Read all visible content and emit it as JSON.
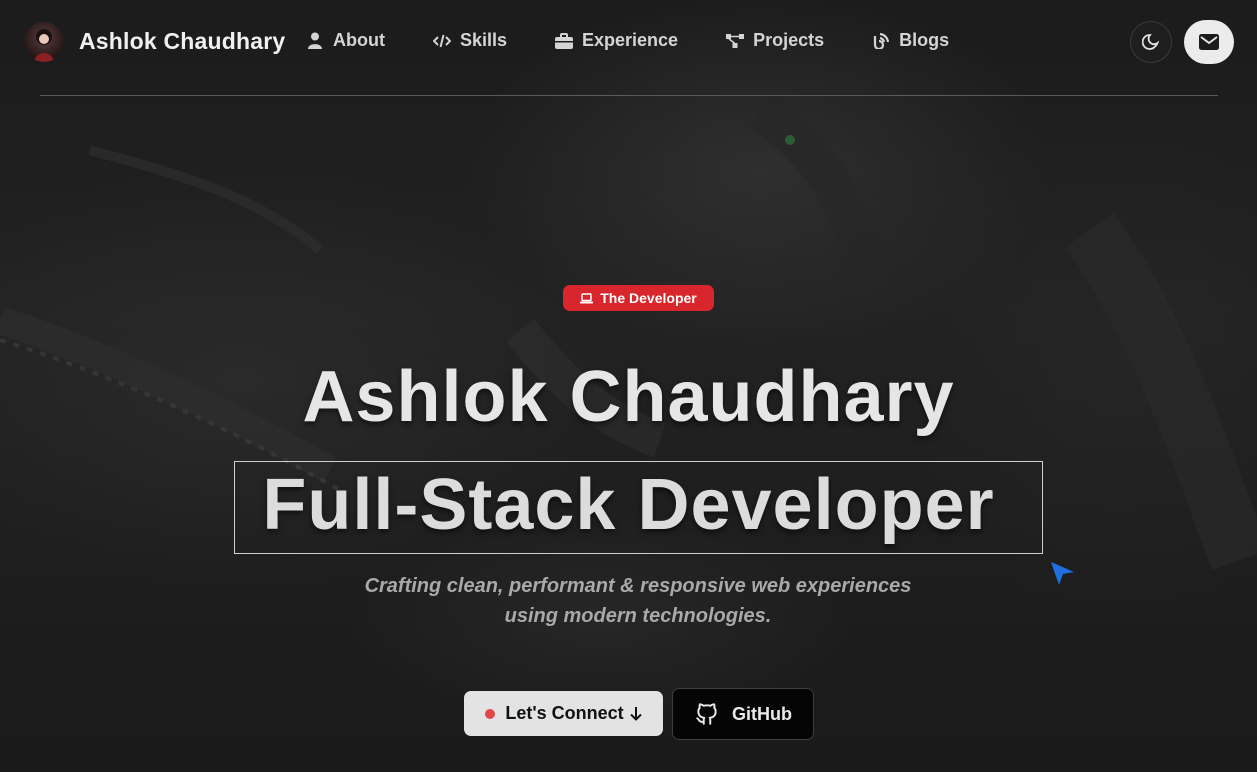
{
  "header": {
    "brand_name": "Ashlok Chaudhary",
    "nav_items": [
      {
        "label": "About",
        "icon": "user-icon"
      },
      {
        "label": "Skills",
        "icon": "code-icon"
      },
      {
        "label": "Experience",
        "icon": "briefcase-icon"
      },
      {
        "label": "Projects",
        "icon": "diagram-icon"
      },
      {
        "label": "Blogs",
        "icon": "blog-icon"
      }
    ],
    "theme_toggle_icon": "moon-icon",
    "contact_icon": "envelope-icon"
  },
  "hero": {
    "badge_label": "The Developer",
    "badge_icon": "laptop-icon",
    "name": "Ashlok Chaudhary",
    "role": "Full-Stack Developer",
    "tagline_line1": "Crafting clean, performant & responsive web experiences",
    "tagline_line2": "using modern technologies.",
    "connect_label": "Let's Connect",
    "github_label": "GitHub"
  },
  "colors": {
    "badge": "#d9262c",
    "connect_dot": "#e04848",
    "cursor": "#1f6fe0",
    "background": "#1b1b1b"
  }
}
